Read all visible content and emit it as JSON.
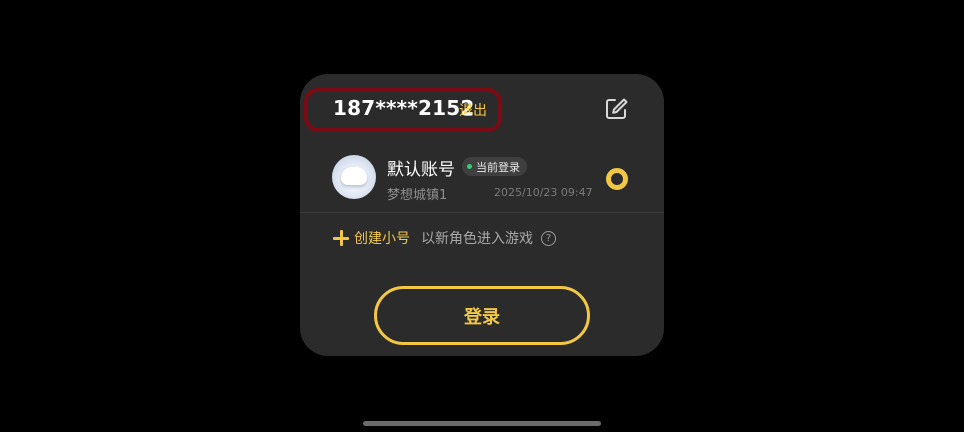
{
  "account_card": {
    "phone": "187****2152",
    "logout_label": "退出",
    "account": {
      "name": "默认账号",
      "current_badge": "当前登录",
      "server": "梦想城镇1",
      "timestamp": "2025/10/23 09:47",
      "selected": true
    },
    "create_alt": {
      "label": "创建小号",
      "description": "以新角色进入游戏",
      "help_glyph": "?"
    },
    "login_button": "登录"
  },
  "icons": {
    "edit": "edit-icon",
    "plus": "plus-icon",
    "help": "help-icon",
    "status_dot": "online-dot-icon"
  },
  "colors": {
    "accent": "#f2c744",
    "card_bg": "#2b2b2b",
    "highlight_border": "#7a0b14",
    "status_green": "#2fd07a"
  }
}
